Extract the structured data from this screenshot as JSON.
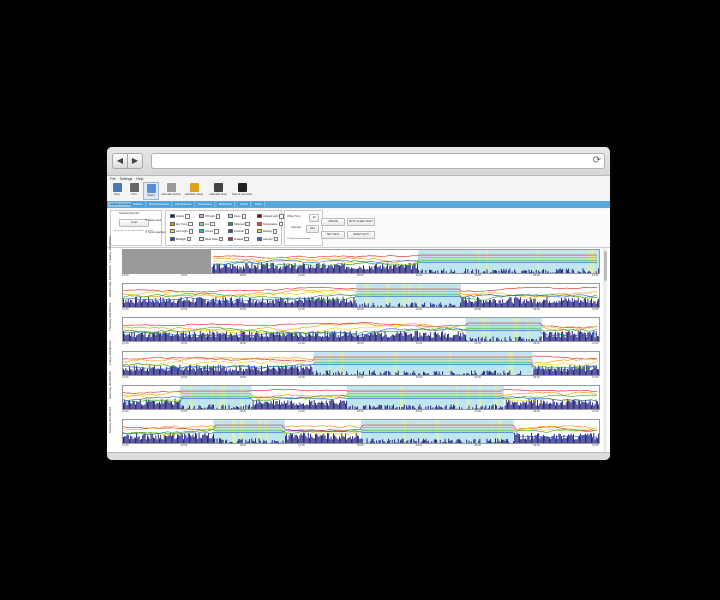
{
  "browser": {
    "back_icon": "◀",
    "forward_icon": "▶",
    "reload_icon": "⟳",
    "url": ""
  },
  "menu": [
    "File",
    "Settings",
    "Help"
  ],
  "toolbar": [
    {
      "label": "Open",
      "color": "#4b78b0"
    },
    {
      "label": "Print",
      "color": "#666666"
    },
    {
      "label": "Select",
      "color": "#5a8ed2"
    },
    {
      "label": "Calculate Activity",
      "color": "#999999"
    },
    {
      "label": "Calculate Sleep",
      "color": "#e0a020"
    },
    {
      "label": "Calculate Stats",
      "color": "#444444"
    },
    {
      "label": "Save & Overwrite",
      "color": "#222222"
    }
  ],
  "tabs": [
    "Actigram Overview",
    "Statistics",
    "Sleep Parameters",
    "Light Exposure",
    "Temperature",
    "Rhythmicity",
    "Activity",
    "Export"
  ],
  "controls": {
    "left_group": {
      "title": "Selecting Results",
      "field_value": "Ovrall",
      "note": "Drag a bar on the plot to define selection",
      "check1": "Select area",
      "check2": "Show quartiles"
    },
    "legend": [
      {
        "label": "Activity",
        "color": "#1a1a7a"
      },
      {
        "label": "Ext. Temp",
        "color": "#ff8c00"
      },
      {
        "label": "Amb Light",
        "color": "#ffe600"
      },
      {
        "label": "Bluelight",
        "color": "#2040ff"
      },
      {
        "label": "Off Light",
        "color": "#b8b8b8"
      },
      {
        "label": "Lux",
        "color": "#8fe38f"
      },
      {
        "label": "Counts",
        "color": "#00c8c8"
      },
      {
        "label": "Wear State",
        "color": "#d2f3fa"
      },
      {
        "label": "Sleep",
        "color": "#b7e0ef"
      },
      {
        "label": "Softened",
        "color": "#22aa22"
      },
      {
        "label": "Contrast",
        "color": "#4040c0"
      },
      {
        "label": "Zscaled",
        "color": "#dd2222"
      },
      {
        "label": "Infrared Light",
        "color": "#7a0a0a"
      },
      {
        "label": "Temperature",
        "color": "#f03c3c"
      },
      {
        "label": "Resting",
        "color": "#c8e840"
      },
      {
        "label": "Intensity",
        "color": "#3070e0"
      }
    ],
    "offset_label": "Offset Time:",
    "offset_value": "10",
    "interval_label": "Intervals:",
    "interval_value": "1Min",
    "overlay_check": "Show interval overlay",
    "btn_update": "UPDATE",
    "btn_settings": "SETTINGS",
    "btn_print": "PRINT SLEEP DIARY",
    "btn_reset": "RESET DAYS"
  },
  "ticks": [
    "12:00",
    "15:00",
    "18:00",
    "21:00",
    "00:00",
    "03:00",
    "06:00",
    "09:00",
    "12:00"
  ],
  "days": [
    {
      "label": "Tuesday 2014/01/21",
      "gray": [
        0,
        0.185
      ],
      "sleep": [
        [
          0.62,
          1.0
        ]
      ],
      "seed": 3
    },
    {
      "label": "Wednesday 2014/01/22",
      "gray": null,
      "sleep": [
        [
          0.49,
          0.71
        ]
      ],
      "seed": 7
    },
    {
      "label": "Thursday 2014/01/23",
      "gray": null,
      "sleep": [
        [
          0.72,
          0.88
        ]
      ],
      "seed": 11
    },
    {
      "label": "Friday 2014/01/24",
      "gray": null,
      "sleep": [
        [
          0.4,
          0.86
        ]
      ],
      "seed": 17
    },
    {
      "label": "Saturday 2014/01/25",
      "gray": null,
      "sleep": [
        [
          0.12,
          0.27
        ],
        [
          0.47,
          0.8
        ]
      ],
      "seed": 23
    },
    {
      "label": "Sunday 2014/01/26",
      "gray": null,
      "sleep": [
        [
          0.19,
          0.34
        ],
        [
          0.5,
          0.82
        ]
      ],
      "seed": 29
    }
  ]
}
